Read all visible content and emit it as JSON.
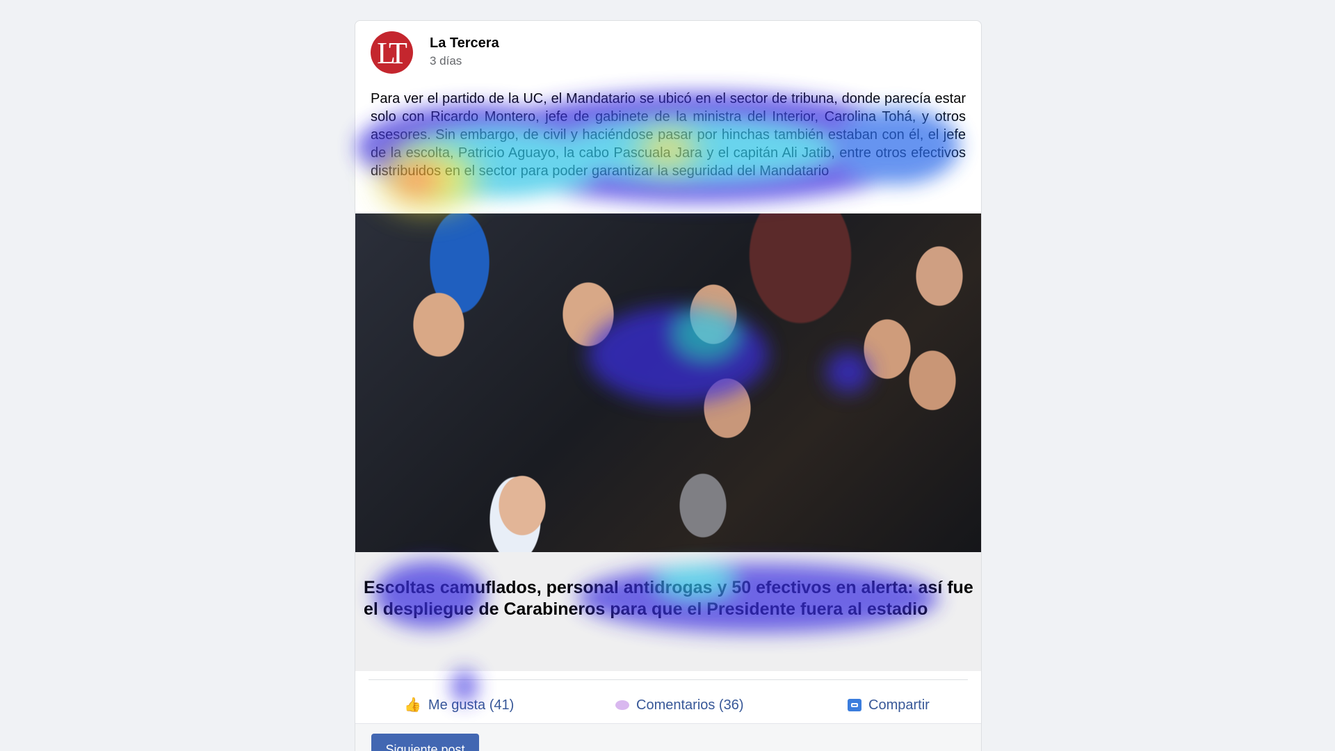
{
  "post": {
    "source": {
      "name": "La Tercera",
      "time": "3 días",
      "avatar_text": "LT",
      "avatar_color": "#c4262e"
    },
    "text": "Para ver el partido de la UC, el Mandatario se ubicó en el sector de tribuna, donde parecía estar solo con Ricardo Montero, jefe de gabinete de la ministra del Interior, Carolina Tohá, y otros asesores. Sin embargo, de civil y haciéndose pasar por hinchas también estaban con él, el jefe de la escolta, Patricio Aguayo, la cabo Pascuala Jara y el capitán Ali Jatib, entre otros efectivos distribuidos en el sector para poder garantizar la seguridad del Mandatario",
    "image": {
      "icon": "crowd-photo"
    },
    "headline": "Escoltas camuflados, personal antidrogas y 50 efectivos en alerta: así fue el despliegue de Carabineros para que el Presidente fuera al estadio"
  },
  "actions": {
    "like": {
      "icon": "thumbs-up-icon",
      "label": "Me gusta (41)"
    },
    "comment": {
      "icon": "speech-bubble-icon",
      "label": "Comentarios (36)"
    },
    "share": {
      "icon": "share-icon",
      "label": "Compartir"
    }
  },
  "footer": {
    "next_label": "Siguiente post"
  },
  "colors": {
    "background": "#f0f2f5",
    "link": "#385898",
    "button": "#4267b2",
    "brand": "#c4262e"
  },
  "overlay": {
    "type": "gaze-heatmap"
  }
}
